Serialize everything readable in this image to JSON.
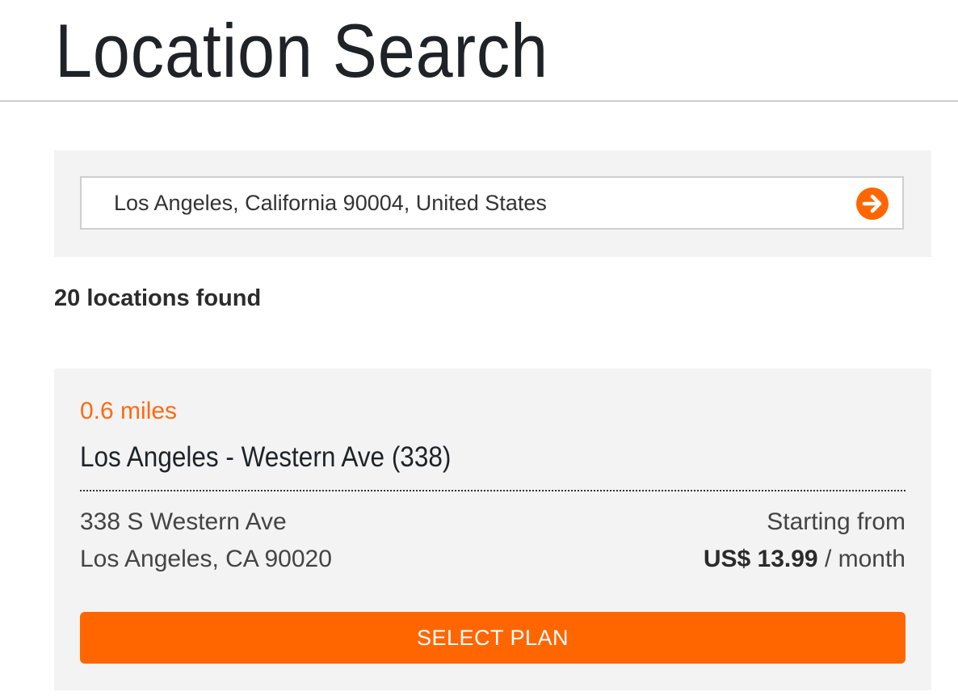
{
  "header": {
    "title": "Location Search"
  },
  "search": {
    "value": "Los Angeles, California 90004, United States",
    "submit_icon": "arrow-right-circle-icon",
    "accent_color": "#ff6600"
  },
  "results": {
    "count_text": "20 locations found",
    "locations": [
      {
        "distance": "0.6 miles",
        "name": "Los Angeles - Western Ave (338)",
        "address_line1": "338 S Western Ave",
        "address_line2": "Los Angeles, CA 90020",
        "price_label": "Starting from",
        "price": "US$ 13.99",
        "price_period": "/ month",
        "select_label": "SELECT PLAN"
      }
    ]
  }
}
